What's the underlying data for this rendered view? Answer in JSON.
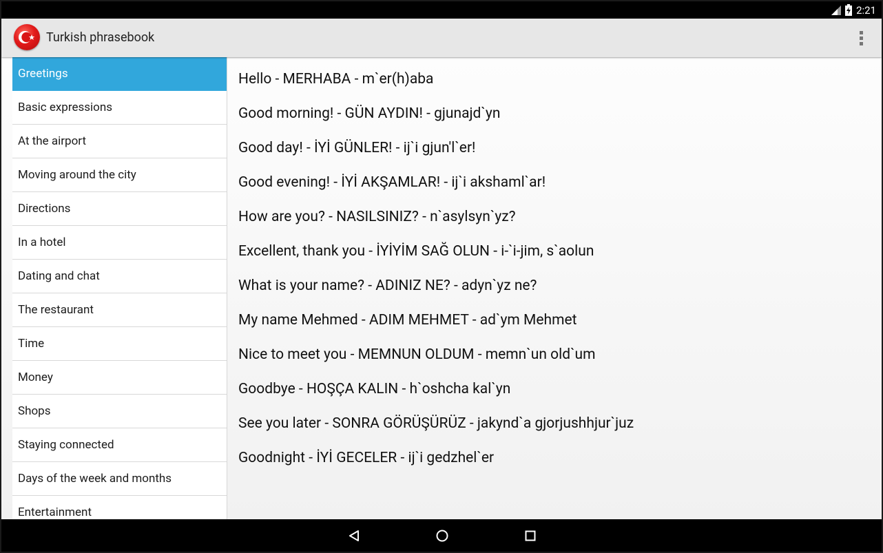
{
  "status_bar": {
    "time": "2:21"
  },
  "app_bar": {
    "title": "Turkish phrasebook"
  },
  "sidebar": {
    "items": [
      {
        "label": "Greetings",
        "active": true
      },
      {
        "label": "Basic expressions"
      },
      {
        "label": "At the airport"
      },
      {
        "label": "Moving around the city"
      },
      {
        "label": "Directions"
      },
      {
        "label": "In a hotel"
      },
      {
        "label": "Dating and chat"
      },
      {
        "label": "The restaurant"
      },
      {
        "label": "Time"
      },
      {
        "label": "Money"
      },
      {
        "label": "Shops"
      },
      {
        "label": "Staying connected"
      },
      {
        "label": "Days of the week and months"
      },
      {
        "label": "Entertainment"
      }
    ]
  },
  "phrases": [
    "Hello - MERHABA - m`er(h)aba",
    "Good morning! - GÜN AYDIN! - gjunajd`yn",
    "Good day! - İYİ GÜNLER! - ij`i gjun'l`er!",
    "Good evening! - İYİ AKŞAMLAR! - ij`i akshaml`ar!",
    "How are you? - NASILSINIZ? - n`asylsyn`yz?",
    "Excellent, thank you - İYİYİM SAĞ OLUN - i-`i-jim, s`aolun",
    "What is your name? - ADINIZ NE? - adyn`yz ne?",
    "My name Mehmed - ADIM MEHMET - ad`ym Mehmet",
    "Nice to meet you - MEMNUN OLDUM - memn`un old`um",
    "Goodbye - HOŞÇA KALIN - h`oshcha kal`yn",
    "See you later - SONRA GÖRÜŞÜRÜZ - jakynd`a gjorjushhjur`juz",
    "Goodnight - İYİ GECELER - ij`i gedzhel`er"
  ],
  "colors": {
    "accent": "#31a7dc",
    "app_bar": "#e7e7e7",
    "logo_red": "#e21b1b"
  },
  "icons": {
    "app_logo": "turkish-flag-icon",
    "overflow": "overflow-menu-icon",
    "nav_back": "back-icon",
    "nav_home": "home-icon",
    "nav_recents": "recents-icon"
  }
}
